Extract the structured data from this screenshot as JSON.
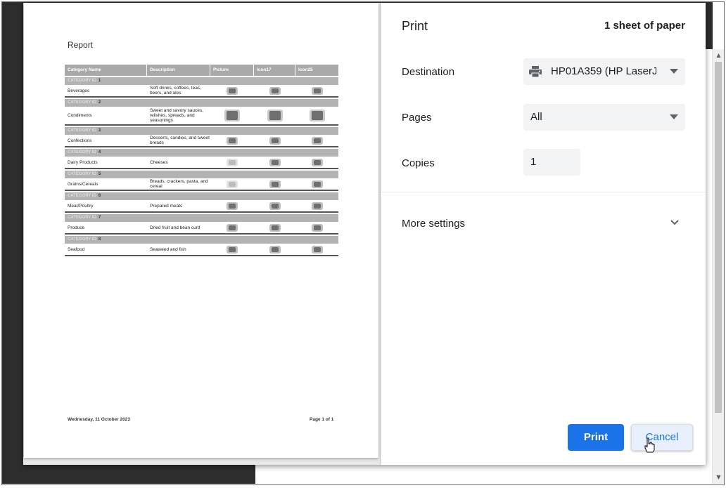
{
  "report": {
    "title": "Report",
    "columns": [
      "Category Name",
      "Description",
      "Picture",
      "Icon17",
      "Icon25"
    ],
    "category_label": "CATEGORY ID",
    "rows": [
      {
        "id": "1",
        "name": "Beverages",
        "description": "Soft drinks, coffees, teas, beers, and ales"
      },
      {
        "id": "2",
        "name": "Condiments",
        "description": "Sweet and savory sauces, relishes, spreads, and seasonings"
      },
      {
        "id": "3",
        "name": "Confections",
        "description": "Desserts, candies, and sweet breads"
      },
      {
        "id": "4",
        "name": "Dairy Products",
        "description": "Cheeses"
      },
      {
        "id": "5",
        "name": "Grains/Cereals",
        "description": "Breads, crackers, pasta, and cereal"
      },
      {
        "id": "6",
        "name": "Meat/Poultry",
        "description": "Prepared meats"
      },
      {
        "id": "7",
        "name": "Produce",
        "description": "Dried fruit and bean curd"
      },
      {
        "id": "8",
        "name": "Seafood",
        "description": "Seaweed and fish"
      }
    ],
    "footer_date": "Wednesday, 11 October 2023",
    "footer_page": "Page 1 of 1"
  },
  "settings": {
    "title": "Print",
    "sheets": "1 sheet of paper",
    "destination_label": "Destination",
    "destination_value": "HP01A359 (HP LaserJe",
    "pages_label": "Pages",
    "pages_value": "All",
    "copies_label": "Copies",
    "copies_value": "1",
    "more_settings": "More settings",
    "print_button": "Print",
    "cancel_button": "Cancel"
  },
  "icons": {
    "printer": "printer-icon",
    "chevron": "chevron-down-icon",
    "cursor": "hand-cursor-icon"
  },
  "colors": {
    "primary": "#1a73e8",
    "field_bg": "#f1f3f4",
    "text": "#202124"
  }
}
